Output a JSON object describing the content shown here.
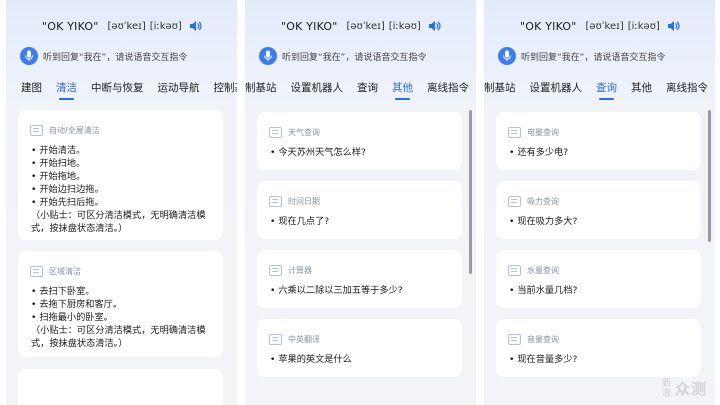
{
  "wake": {
    "word": "\"OK YIKO\"",
    "phonetic_1": "[əʊˈkeɪ]",
    "phonetic_2": "[iːkəʊ]",
    "hint": "听到回复“我在”，请说语音交互指令"
  },
  "colors": {
    "accent": "#2e6be0",
    "mic": "#3c7bf0",
    "scrollbar": "#9a9aa0"
  },
  "panels": [
    {
      "tabs": [
        {
          "label": "建图"
        },
        {
          "label": "清洁",
          "active": true
        },
        {
          "label": "中断与恢复"
        },
        {
          "label": "运动导航"
        },
        {
          "label": "控制基"
        }
      ],
      "cards": [
        {
          "title": "自动/全屋清洁",
          "commands": [
            "开始清洁。",
            "开始扫地。",
            "开始拖地。",
            "开始边扫边拖。",
            "开始先扫后拖。"
          ],
          "note": "（小贴士：可区分清洁模式，无明确清洁模式，按抹盘状态清洁。）"
        },
        {
          "title": "区域清洁",
          "commands": [
            "去扫下卧室。",
            "去拖下厨房和客厅。",
            "扫拖最小的卧室。"
          ],
          "note": "（小贴士：可区分清洁模式，无明确清洁模式，按抹盘状态清洁。）"
        }
      ]
    },
    {
      "tabs": [
        {
          "label": "制基站"
        },
        {
          "label": "设置机器人"
        },
        {
          "label": "查询"
        },
        {
          "label": "其他",
          "active": true
        },
        {
          "label": "离线指令"
        }
      ],
      "cards": [
        {
          "title": "天气查询",
          "commands": [
            "今天苏州天气怎么样?"
          ]
        },
        {
          "title": "时间日期",
          "commands": [
            "现在几点了?"
          ]
        },
        {
          "title": "计算器",
          "commands": [
            "六乘以二除以三加五等于多少?"
          ]
        },
        {
          "title": "中英翻译",
          "commands": [
            "苹果的英文是什么"
          ]
        }
      ]
    },
    {
      "tabs": [
        {
          "label": "制基站"
        },
        {
          "label": "设置机器人"
        },
        {
          "label": "查询",
          "active": true
        },
        {
          "label": "其他"
        },
        {
          "label": "离线指令"
        }
      ],
      "cards": [
        {
          "title": "电量查询",
          "commands": [
            "还有多少电?"
          ]
        },
        {
          "title": "吸力查询",
          "commands": [
            "现在吸力多大?"
          ]
        },
        {
          "title": "水量查询",
          "commands": [
            "当前水量几档?"
          ]
        },
        {
          "title": "音量查询",
          "commands": [
            "现在音量多少?"
          ]
        }
      ]
    }
  ],
  "watermark": {
    "line1": "新",
    "line2": "浪",
    "brand": "众测"
  }
}
